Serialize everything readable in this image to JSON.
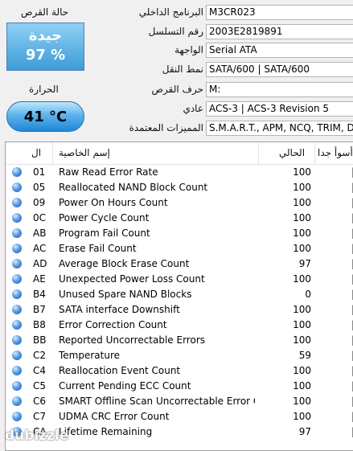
{
  "health": {
    "label": "حالة القرص",
    "status": "جيدة",
    "percent": "97 %"
  },
  "temperature": {
    "label": "الحرارة",
    "value": "41 °C"
  },
  "info": [
    {
      "label": "البرنامج الداخلي",
      "value": "M3CR023"
    },
    {
      "label": "رقم التسلسل",
      "value": "2003E2819891"
    },
    {
      "label": "الواجهة",
      "value": "Serial ATA"
    },
    {
      "label": "نمط النقل",
      "value": "SATA/600 | SATA/600"
    },
    {
      "label": "حرف القرص",
      "value": "M:"
    },
    {
      "label": "عادي",
      "value": "ACS-3 | ACS-3 Revision 5"
    },
    {
      "label": "المميزات المعتمدة",
      "value": "S.M.A.R.T., APM, NCQ, TRIM, DevS"
    }
  ],
  "table": {
    "headers": {
      "id": "ال",
      "name": "إسم الخاصية",
      "current": "الحالي",
      "worst": "أسوأ جدا"
    },
    "rows": [
      {
        "id": "01",
        "name": "Raw Read Error Rate",
        "current": "100"
      },
      {
        "id": "05",
        "name": "Reallocated NAND Block Count",
        "current": "100"
      },
      {
        "id": "09",
        "name": "Power On Hours Count",
        "current": "100"
      },
      {
        "id": "0C",
        "name": "Power Cycle Count",
        "current": "100"
      },
      {
        "id": "AB",
        "name": "Program Fail Count",
        "current": "100"
      },
      {
        "id": "AC",
        "name": "Erase Fail Count",
        "current": "100"
      },
      {
        "id": "AD",
        "name": "Average Block Erase Count",
        "current": "97"
      },
      {
        "id": "AE",
        "name": "Unexpected Power Loss Count",
        "current": "100"
      },
      {
        "id": "B4",
        "name": "Unused Spare NAND Blocks",
        "current": "0"
      },
      {
        "id": "B7",
        "name": "SATA interface Downshift",
        "current": "100"
      },
      {
        "id": "B8",
        "name": "Error Correction Count",
        "current": "100"
      },
      {
        "id": "BB",
        "name": "Reported Uncorrectable Errors",
        "current": "100"
      },
      {
        "id": "C2",
        "name": "Temperature",
        "current": "59"
      },
      {
        "id": "C4",
        "name": "Reallocation Event Count",
        "current": "100"
      },
      {
        "id": "C5",
        "name": "Current Pending ECC Count",
        "current": "100"
      },
      {
        "id": "C6",
        "name": "SMART Offline Scan Uncorrectable Error Cou...",
        "current": "100"
      },
      {
        "id": "C7",
        "name": "UDMA CRC Error Count",
        "current": "100"
      },
      {
        "id": "CA",
        "name": "Lifetime Remaining",
        "current": "97"
      }
    ]
  },
  "watermark": "dubizzle",
  "colors": {
    "health_bg": "#3d9bd8",
    "status_dot": "#5a9ce6"
  }
}
